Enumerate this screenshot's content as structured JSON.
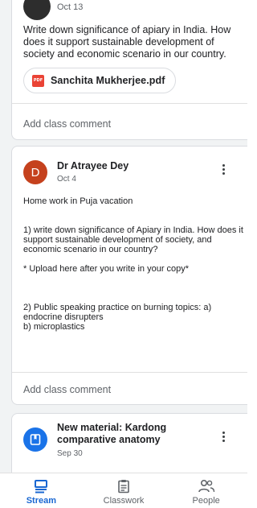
{
  "feed": {
    "post1": {
      "date": "Oct 13",
      "text": "Write down significance of apiary in India. How does it support sustainable development of society and economic scenario in our country.",
      "attachment": {
        "type_badge": "PDF",
        "name": "Sanchita Mukherjee.pdf"
      },
      "comment_label": "Add class comment"
    },
    "post2": {
      "author_initial": "D",
      "author": "Dr Atrayee Dey",
      "date": "Oct 4",
      "text": "Home work in Puja vacation\n\n\n1) write down significance of Apiary in India. How does it support sustainable development of society, and economic scenario in our country?\n\n* Upload here after you write in your copy*\n\n\n\n2) Public speaking practice on burning topics: a) endocrine disrupters\n          b) microplastics",
      "comment_label": "Add class comment"
    },
    "post3": {
      "title": "New material: Kardong comparative anatomy",
      "date": "Sep 30"
    }
  },
  "bottom_nav": {
    "items": [
      {
        "label": "Stream",
        "icon": "stream-icon",
        "active": true
      },
      {
        "label": "Classwork",
        "icon": "classwork-icon",
        "active": false
      },
      {
        "label": "People",
        "icon": "people-icon",
        "active": false
      }
    ]
  },
  "colors": {
    "accent": "#1967d2",
    "avatar_d": "#c5411d",
    "material_avatar": "#1a73e8",
    "pdf_badge": "#ea4335"
  }
}
